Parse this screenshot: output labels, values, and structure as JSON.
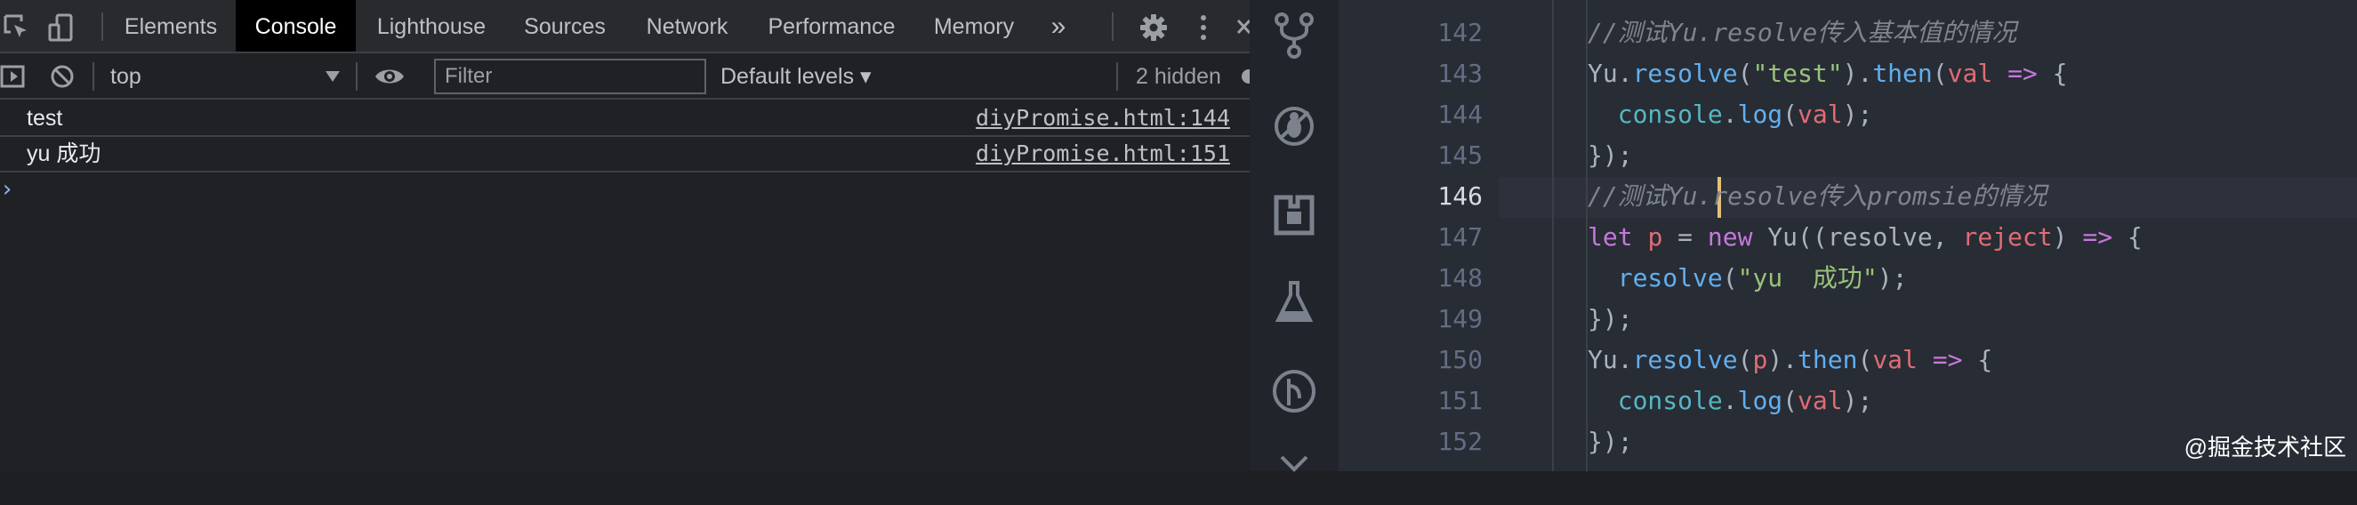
{
  "devtools": {
    "tabs": [
      "Elements",
      "Console",
      "Lighthouse",
      "Sources",
      "Network",
      "Performance",
      "Memory"
    ],
    "active_tab": "Console",
    "more_tabs": "»",
    "context": "top",
    "filter_placeholder": "Filter",
    "levels": "Default levels ▾",
    "hidden": "2 hidden",
    "messages": [
      {
        "text": "test",
        "source": "diyPromise.html:144"
      },
      {
        "text": "yu  成功",
        "source": "diyPromise.html:151"
      }
    ],
    "prompt": "›"
  },
  "editor": {
    "line_numbers": [
      "142",
      "143",
      "144",
      "145",
      "146",
      "147",
      "148",
      "149",
      "150",
      "151",
      "152"
    ],
    "current_line": "146",
    "lines": [
      "//测试Yu.resolve传入基本值的情况",
      "Yu.resolve(\"test\").then(val => {",
      "  console.log(val);",
      "});",
      "//测试Yu.resolve传入promsie的情况",
      "let p = new Yu((resolve, reject) => {",
      "  resolve(\"yu  成功\");",
      "});",
      "Yu.resolve(p).then(val => {",
      "  console.log(val);",
      "});"
    ]
  },
  "watermark": "@掘金技术社区"
}
